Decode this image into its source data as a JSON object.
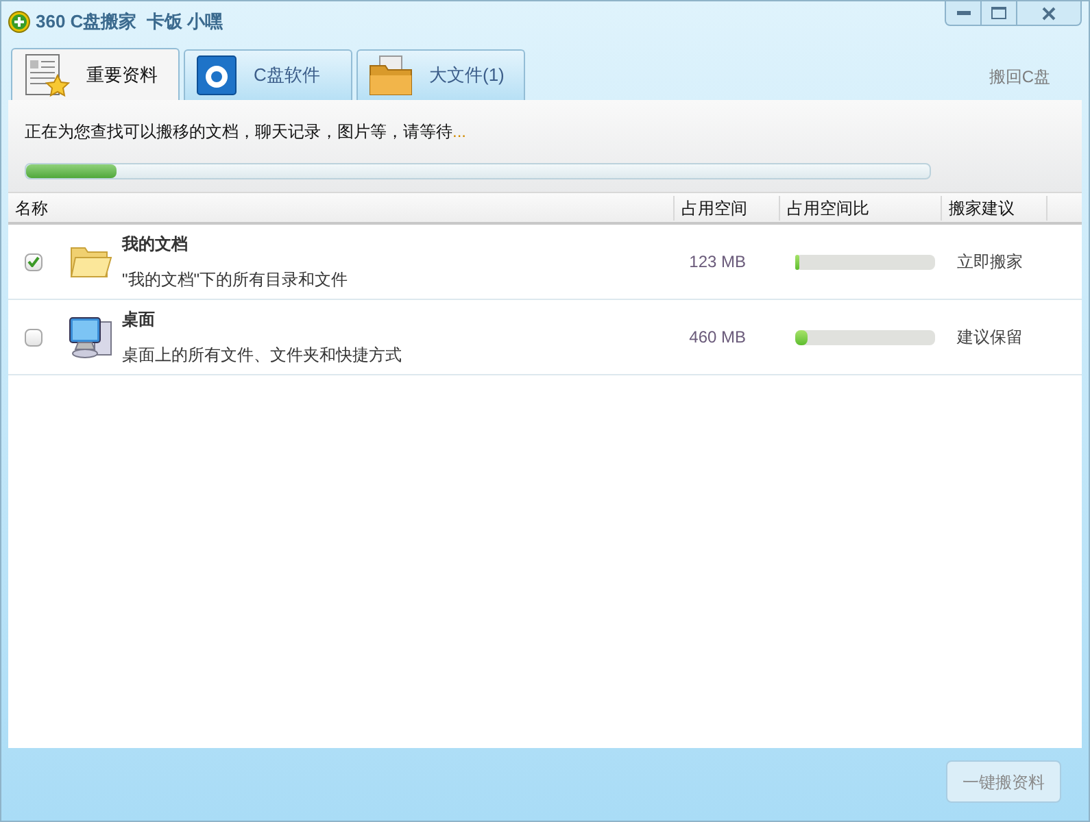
{
  "window": {
    "title": "360 C盘搬家  卡饭 小嘿"
  },
  "tabs": [
    {
      "label": "重要资料",
      "selected": true,
      "kind": "docs"
    },
    {
      "label": "C盘软件",
      "selected": false,
      "kind": "software"
    },
    {
      "label": "大文件(1)",
      "selected": false,
      "kind": "bigfiles"
    }
  ],
  "restore_link": "搬回C盘",
  "scan": {
    "text": "正在为您查找可以搬移的文档，聊天记录，图片等，请等待",
    "ellipsis": "...",
    "level": 0.1
  },
  "table": {
    "columns": [
      "名称",
      "占用空间",
      "占用空间比",
      "搬家建议"
    ],
    "rows": [
      {
        "kind": "folder",
        "checked": true,
        "title": "我的文档",
        "description": "\"我的文档\"下的所有目录和文件",
        "size": "123 MB",
        "level": 0.03,
        "suggestion": "立即搬家"
      },
      {
        "kind": "computer",
        "checked": false,
        "title": "桌面",
        "description": "桌面上的所有文件、文件夹和快捷方式",
        "size": "460 MB",
        "level": 0.09,
        "suggestion": "建议保留"
      }
    ]
  },
  "action_button": {
    "label": "一键搬资料",
    "disabled": true
  }
}
